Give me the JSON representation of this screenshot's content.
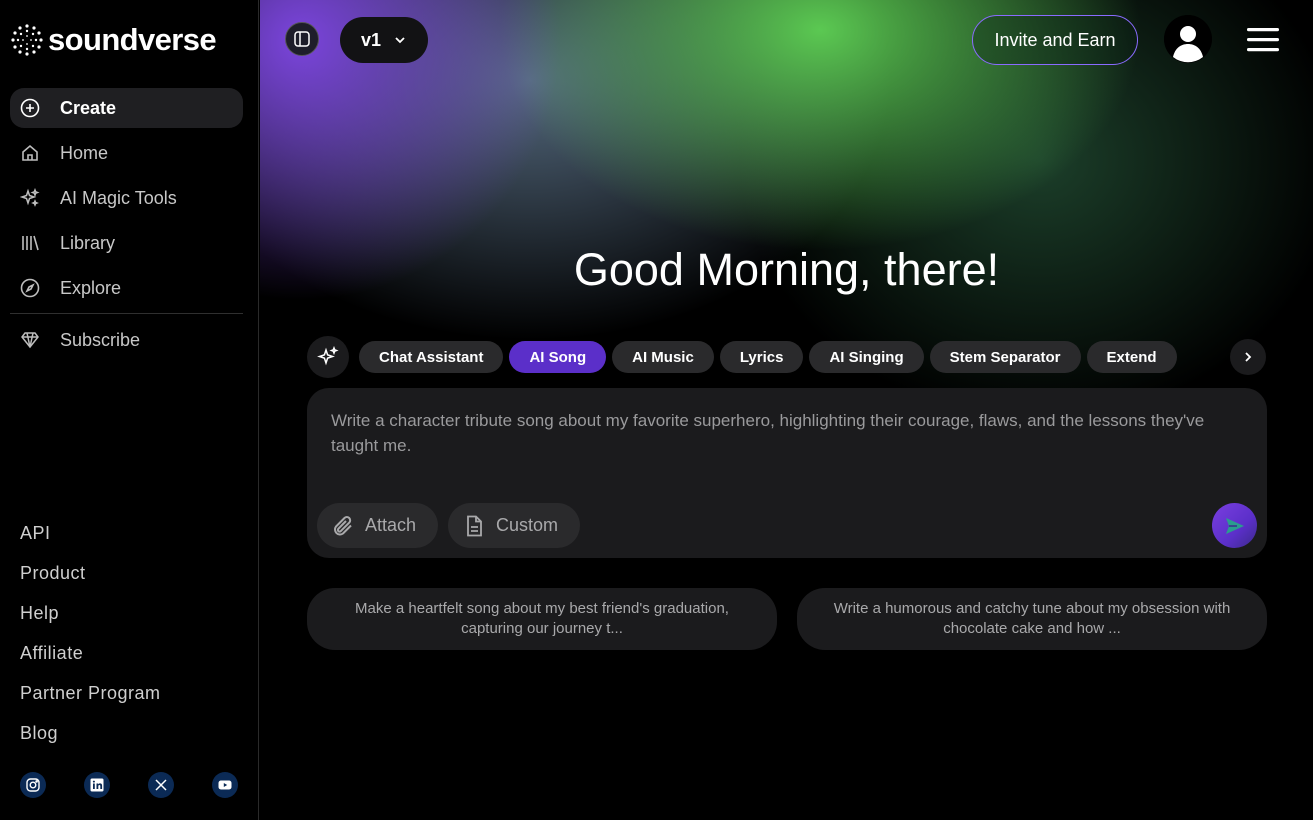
{
  "brand": {
    "name": "soundverse"
  },
  "sidebar": {
    "nav": [
      {
        "label": "Create",
        "icon": "plus-circle-icon",
        "active": true
      },
      {
        "label": "Home",
        "icon": "home-icon",
        "active": false
      },
      {
        "label": "AI Magic Tools",
        "icon": "sparkles-icon",
        "active": false
      },
      {
        "label": "Library",
        "icon": "library-icon",
        "active": false
      },
      {
        "label": "Explore",
        "icon": "compass-icon",
        "active": false
      }
    ],
    "subscribe": {
      "label": "Subscribe",
      "icon": "diamond-icon"
    },
    "footer_links": [
      "API",
      "Product",
      "Help",
      "Affiliate",
      "Partner Program",
      "Blog"
    ],
    "socials": [
      "instagram-icon",
      "linkedin-icon",
      "x-icon",
      "youtube-icon"
    ]
  },
  "header": {
    "version": "v1",
    "invite_label": "Invite and Earn"
  },
  "main": {
    "greeting": "Good Morning, there!",
    "tabs": [
      {
        "label": "Chat Assistant",
        "active": false
      },
      {
        "label": "AI Song",
        "active": true
      },
      {
        "label": "AI Music",
        "active": false
      },
      {
        "label": "Lyrics",
        "active": false
      },
      {
        "label": "AI Singing",
        "active": false
      },
      {
        "label": "Stem Separator",
        "active": false
      },
      {
        "label": "Extend",
        "active": false
      }
    ],
    "prompt_placeholder": "Write a character tribute song about my favorite superhero, highlighting their courage, flaws, and the lessons they've taught me.",
    "attach_label": "Attach",
    "custom_label": "Custom",
    "suggestions": [
      "Make a heartfelt song about my best friend's graduation, capturing our journey t...",
      "Write a humorous and catchy tune about my obsession with chocolate cake and how ..."
    ]
  },
  "colors": {
    "accent": "#5b2fc9",
    "invite_border": "#8a6bff",
    "panel": "#1b1b1d"
  }
}
